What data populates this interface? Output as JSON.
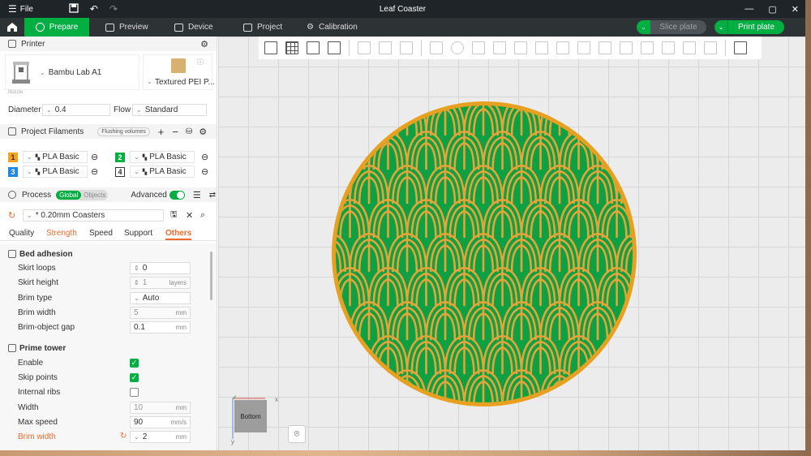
{
  "window": {
    "title": "Leaf Coaster",
    "menu_label": "File"
  },
  "tabs": [
    {
      "label": "Prepare"
    },
    {
      "label": "Preview"
    },
    {
      "label": "Device"
    },
    {
      "label": "Project"
    },
    {
      "label": "Calibration"
    }
  ],
  "actions": {
    "slice_label": "Slice plate",
    "print_label": "Print plate"
  },
  "printer": {
    "section_label": "Printer",
    "name": "Bambu Lab A1",
    "plate": "Textured PEI P...",
    "nozzle_label": "Nozzle",
    "diameter_label": "Diameter",
    "diameter_value": "0.4",
    "flow_label": "Flow",
    "flow_value": "Standard"
  },
  "filaments": {
    "section_label": "Project Filaments",
    "flushing_label": "Flushing volumes",
    "items": [
      {
        "num": "1",
        "name": "PLA Basic",
        "color": "#f4a11b"
      },
      {
        "num": "2",
        "name": "PLA Basic",
        "color": "#00ae42"
      },
      {
        "num": "3",
        "name": "PLA Basic",
        "color": "#1e88e5"
      },
      {
        "num": "4",
        "name": "PLA Basic",
        "color": "#ffffff"
      }
    ]
  },
  "process": {
    "section_label": "Process",
    "global_label": "Global",
    "objects_label": "Objects",
    "advanced_label": "Advanced",
    "preset": "* 0.20mm Coasters",
    "subtabs": [
      "Quality",
      "Strength",
      "Speed",
      "Support",
      "Others"
    ]
  },
  "bed_adhesion": {
    "title": "Bed adhesion",
    "skirt_loops_label": "Skirt loops",
    "skirt_loops_value": "0",
    "skirt_height_label": "Skirt height",
    "skirt_height_value": "1",
    "skirt_height_unit": "layers",
    "brim_type_label": "Brim type",
    "brim_type_value": "Auto",
    "brim_width_label": "Brim width",
    "brim_width_value": "5",
    "brim_width_unit": "mm",
    "brim_gap_label": "Brim-object gap",
    "brim_gap_value": "0.1",
    "brim_gap_unit": "mm"
  },
  "prime_tower": {
    "title": "Prime tower",
    "enable_label": "Enable",
    "skip_points_label": "Skip points",
    "internal_ribs_label": "Internal ribs",
    "width_label": "Width",
    "width_value": "10",
    "width_unit": "mm",
    "max_speed_label": "Max speed",
    "max_speed_value": "90",
    "max_speed_unit": "mm/s",
    "brim_width_label": "Brim width",
    "brim_width_value": "2",
    "brim_width_unit": "mm"
  },
  "viewport": {
    "view_label": "Bottom",
    "axis_x": "x",
    "axis_y": "y",
    "coaster_colors": {
      "rim": "#e8a020",
      "fill": "#0ea043",
      "lines": "#e5a43a"
    }
  },
  "colors": {
    "accent": "#00ae42",
    "modified": "#f06a2b",
    "titlebar": "#1f2428"
  }
}
